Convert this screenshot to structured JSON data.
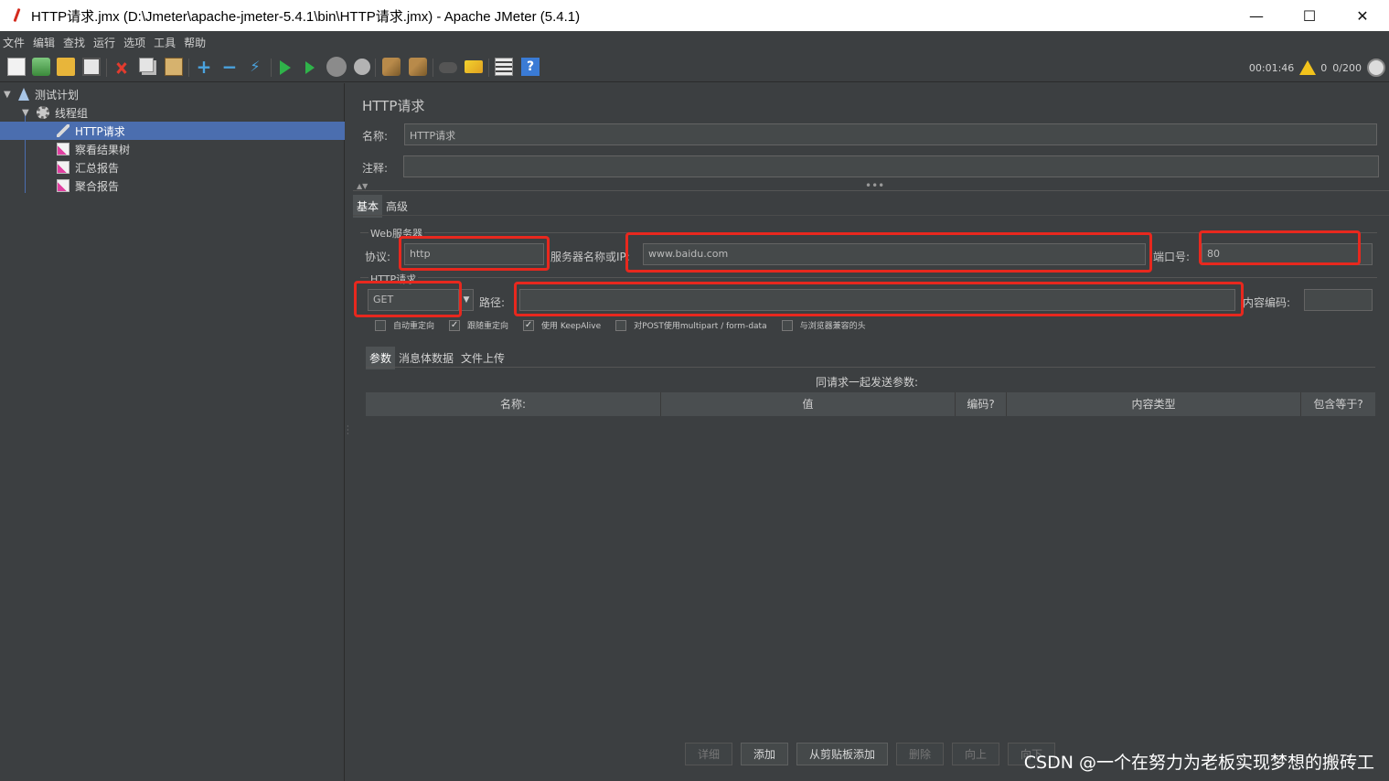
{
  "window": {
    "title": "HTTP请求.jmx (D:\\Jmeter\\apache-jmeter-5.4.1\\bin\\HTTP请求.jmx) - Apache JMeter (5.4.1)",
    "minimize": "—",
    "maximize": "☐",
    "close": "✕"
  },
  "menu": [
    "文件",
    "编辑",
    "查找",
    "运行",
    "选项",
    "工具",
    "帮助"
  ],
  "toolbar": {
    "add": "+",
    "remove": "−",
    "toggle": "⚡",
    "help": "?"
  },
  "status": {
    "elapsed": "00:01:46",
    "warnings": "0",
    "threads": "0/200"
  },
  "tree": {
    "items": [
      {
        "label": "测试计划",
        "icon": "flask-icon"
      },
      {
        "label": "线程组",
        "icon": "gear-icon"
      },
      {
        "label": "HTTP请求",
        "icon": "sampler-icon"
      },
      {
        "label": "察看结果树",
        "icon": "graph-icon"
      },
      {
        "label": "汇总报告",
        "icon": "graph-icon"
      },
      {
        "label": "聚合报告",
        "icon": "graph-icon"
      }
    ]
  },
  "panel": {
    "title": "HTTP请求",
    "name_label": "名称:",
    "name_value": "HTTP请求",
    "comment_label": "注释:",
    "comment_value": "",
    "tabs": [
      "基本",
      "高级"
    ],
    "web_server_label": "Web服务器",
    "protocol_label": "协议:",
    "protocol_value": "http",
    "server_label": "服务器名称或IP:",
    "server_value": "www.baidu.com",
    "port_label": "端口号:",
    "port_value": "80",
    "http_request_label": "HTTP请求",
    "method_value": "GET",
    "path_label": "路径:",
    "path_value": "",
    "encoding_label": "内容编码:",
    "encoding_value": "",
    "checkboxes": [
      {
        "label": "自动重定向",
        "checked": false
      },
      {
        "label": "跟随重定向",
        "checked": true
      },
      {
        "label": "使用 KeepAlive",
        "checked": true
      },
      {
        "label": "对POST使用multipart / form-data",
        "checked": false
      },
      {
        "label": "与浏览器兼容的头",
        "checked": false
      }
    ],
    "sub_tabs": [
      "参数",
      "消息体数据",
      "文件上传"
    ],
    "params_caption": "同请求一起发送参数:",
    "columns": [
      "名称:",
      "值",
      "编码?",
      "内容类型",
      "包含等于?"
    ],
    "buttons": {
      "detail": "详细",
      "add": "添加",
      "add_clipboard": "从剪贴板添加",
      "delete": "删除",
      "up": "向上",
      "down": "向下"
    }
  },
  "watermark": "CSDN @一个在努力为老板实现梦想的搬砖工"
}
